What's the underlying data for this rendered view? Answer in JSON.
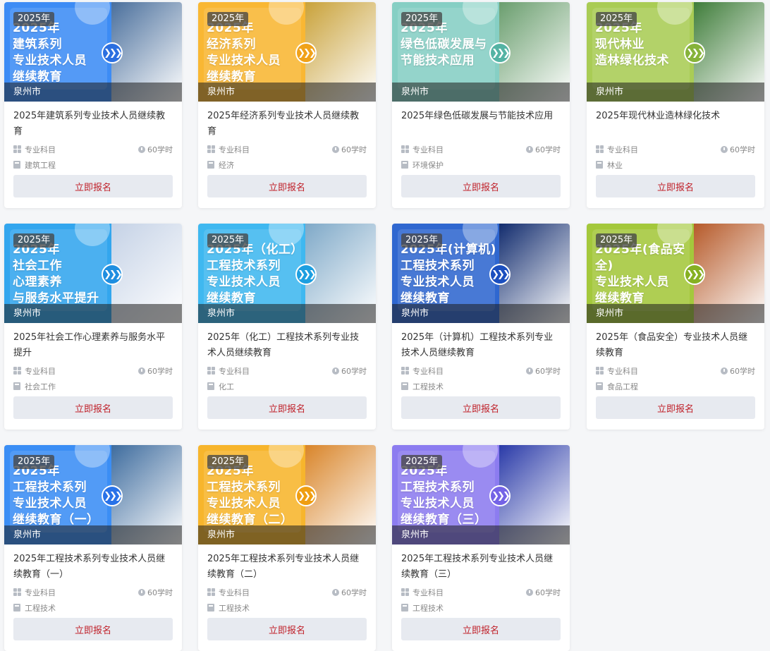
{
  "courses": [
    {
      "year_badge": "2025年",
      "banner_text": "2025年\n建筑系列\n专业技术人员\n继续教育",
      "city": "泉州市",
      "title": "2025年建筑系列专业技术人员继续教育",
      "subject_label": "专业科目",
      "hours": "60学时",
      "category": "建筑工程",
      "enroll_label": "立即报名",
      "left_color": "#3d8cf5",
      "right_color": "#4a6f9c",
      "arrow_color": "#2b6fe0"
    },
    {
      "year_badge": "2025年",
      "banner_text": "2025年\n经济系列\n专业技术人员\n继续教育",
      "city": "泉州市",
      "title": "2025年经济系列专业技术人员继续教育",
      "subject_label": "专业科目",
      "hours": "60学时",
      "category": "经济",
      "enroll_label": "立即报名",
      "left_color": "#f9b733",
      "right_color": "#c9a23a",
      "arrow_color": "#f0a21a"
    },
    {
      "year_badge": "2025年",
      "banner_text": "2025年\n绿色低碳发展与\n节能技术应用",
      "city": "泉州市",
      "title": "2025年绿色低碳发展与节能技术应用",
      "subject_label": "专业科目",
      "hours": "60学时",
      "category": "环境保护",
      "enroll_label": "立即报名",
      "left_color": "#86cfc4",
      "right_color": "#6a9e6e",
      "arrow_color": "#54b3a4"
    },
    {
      "year_badge": "2025年",
      "banner_text": "2025年\n现代林业\n造林绿化技术",
      "city": "泉州市",
      "title": "2025年现代林业造林绿化技术",
      "subject_label": "专业科目",
      "hours": "60学时",
      "category": "林业",
      "enroll_label": "立即报名",
      "left_color": "#a9cc55",
      "right_color": "#3f7d3a",
      "arrow_color": "#86b33a"
    },
    {
      "year_badge": "2025年",
      "banner_text": "2025年\n社会工作\n心理素养\n与服务水平提升",
      "city": "泉州市",
      "title": "2025年社会工作心理素养与服务水平提升",
      "subject_label": "专业科目",
      "hours": "60学时",
      "category": "社会工作",
      "enroll_label": "立即报名",
      "left_color": "#33a6ee",
      "right_color": "#c5d2e6",
      "arrow_color": "#1f8ee0"
    },
    {
      "year_badge": "2025年",
      "banner_text": "2025年（化工）\n工程技术系列\n专业技术人员\n继续教育",
      "city": "泉州市",
      "title": "2025年（化工）工程技术系列专业技术人员继续教育",
      "subject_label": "专业科目",
      "hours": "60学时",
      "category": "化工",
      "enroll_label": "立即报名",
      "left_color": "#3fb8f0",
      "right_color": "#7fa9c8",
      "arrow_color": "#1e9fe0"
    },
    {
      "year_badge": "2025年",
      "banner_text": "2025年(计算机)\n工程技术系列\n专业技术人员\n继续教育",
      "city": "泉州市",
      "title": "2025年（计算机）工程技术系列专业技术人员继续教育",
      "subject_label": "专业科目",
      "hours": "60学时",
      "category": "工程技术",
      "enroll_label": "立即报名",
      "left_color": "#2f67d0",
      "right_color": "#122c6e",
      "arrow_color": "#1b4fbf"
    },
    {
      "year_badge": "2025年",
      "banner_text": "2025年(食品安全)\n专业技术人员\n继续教育",
      "city": "泉州市",
      "title": "2025年（食品安全）专业技术人员继续教育",
      "subject_label": "专业科目",
      "hours": "60学时",
      "category": "食品工程",
      "enroll_label": "立即报名",
      "left_color": "#a4c83c",
      "right_color": "#b65a2a",
      "arrow_color": "#86b022"
    },
    {
      "year_badge": "2025年",
      "banner_text": "2025年\n工程技术系列\n专业技术人员\n继续教育（一）",
      "city": "泉州市",
      "title": "2025年工程技术系列专业技术人员继续教育（一）",
      "subject_label": "专业科目",
      "hours": "60学时",
      "category": "工程技术",
      "enroll_label": "立即报名",
      "left_color": "#3b8ef5",
      "right_color": "#3e6c9e",
      "arrow_color": "#2872e8"
    },
    {
      "year_badge": "2025年",
      "banner_text": "2025年\n工程技术系列\n专业技术人员\n继续教育（二）",
      "city": "泉州市",
      "title": "2025年工程技术系列专业技术人员继续教育（二）",
      "subject_label": "专业科目",
      "hours": "60学时",
      "category": "工程技术",
      "enroll_label": "立即报名",
      "left_color": "#f7b52c",
      "right_color": "#d9852a",
      "arrow_color": "#ef9e12"
    },
    {
      "year_badge": "2025年",
      "banner_text": "2025年\n工程技术系列\n专业技术人员\n继续教育（三）",
      "city": "泉州市",
      "title": "2025年工程技术系列专业技术人员继续教育（三）",
      "subject_label": "专业科目",
      "hours": "60学时",
      "category": "工程技术",
      "enroll_label": "立即报名",
      "left_color": "#8c7cf0",
      "right_color": "#2a3aa8",
      "arrow_color": "#7463e6"
    }
  ]
}
